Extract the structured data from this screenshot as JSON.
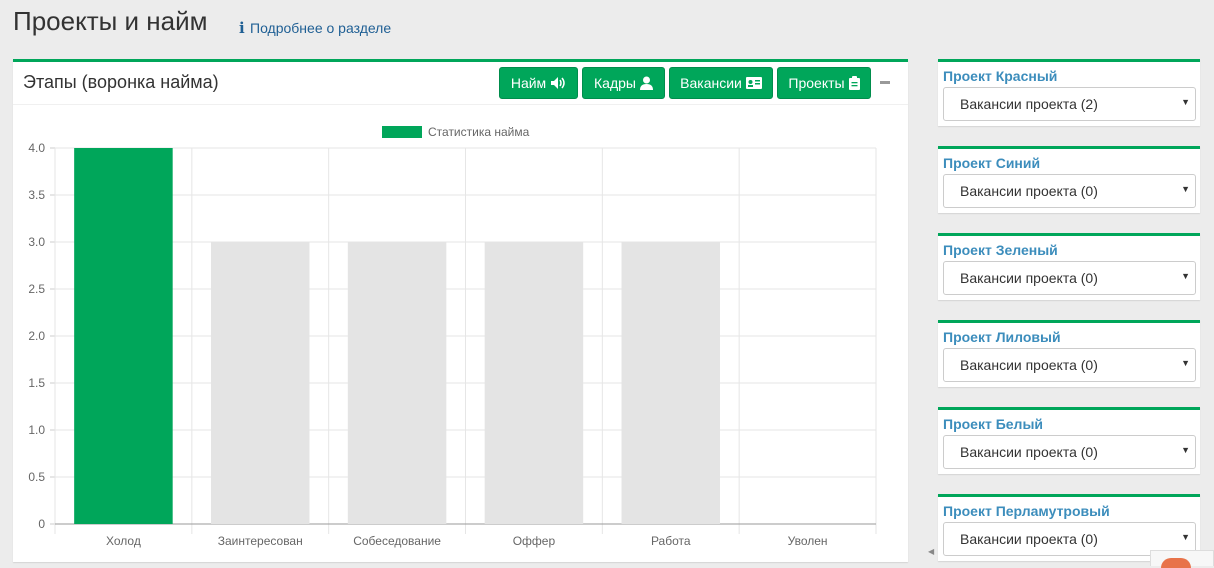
{
  "page": {
    "title": "Проекты и найм",
    "info_link": "Подробнее о разделе"
  },
  "funnel_box": {
    "title": "Этапы (воронка найма)",
    "buttons": [
      {
        "label": "Найм",
        "icon": "volume-icon"
      },
      {
        "label": "Кадры",
        "icon": "user-icon"
      },
      {
        "label": "Вакансии",
        "icon": "id-card-icon"
      },
      {
        "label": "Проекты",
        "icon": "clipboard-icon"
      }
    ]
  },
  "chart_data": {
    "type": "bar",
    "categories": [
      "Холод",
      "Заинтересован",
      "Собеседование",
      "Оффер",
      "Работа",
      "Уволен"
    ],
    "series": [
      {
        "name": "Статистика найма",
        "values": [
          4,
          3,
          3,
          3,
          3,
          0
        ],
        "colors": [
          "#00a65a",
          "#e4e4e4",
          "#e4e4e4",
          "#e4e4e4",
          "#e4e4e4",
          "#e4e4e4"
        ]
      }
    ],
    "ylim": [
      0,
      4
    ],
    "yticks": [
      "0",
      "0.5",
      "1.0",
      "1.5",
      "2.0",
      "2.5",
      "3.0",
      "3.5",
      "4.0"
    ],
    "legend_position": "top",
    "grid": true
  },
  "projects": [
    {
      "name": "Проект Красный",
      "select_value": "Вакансии проекта (2)"
    },
    {
      "name": "Проект Синий",
      "select_value": "Вакансии проекта (0)"
    },
    {
      "name": "Проект Зеленый",
      "select_value": "Вакансии проекта (0)"
    },
    {
      "name": "Проект Лиловый",
      "select_value": "Вакансии проекта (0)"
    },
    {
      "name": "Проект Белый",
      "select_value": "Вакансии проекта (0)"
    },
    {
      "name": "Проект Перламутровый",
      "select_value": "Вакансии проекта (0)"
    }
  ],
  "colors": {
    "accent": "#00a65a",
    "link": "#3c8dbc",
    "bar_inactive": "#e4e4e4"
  }
}
